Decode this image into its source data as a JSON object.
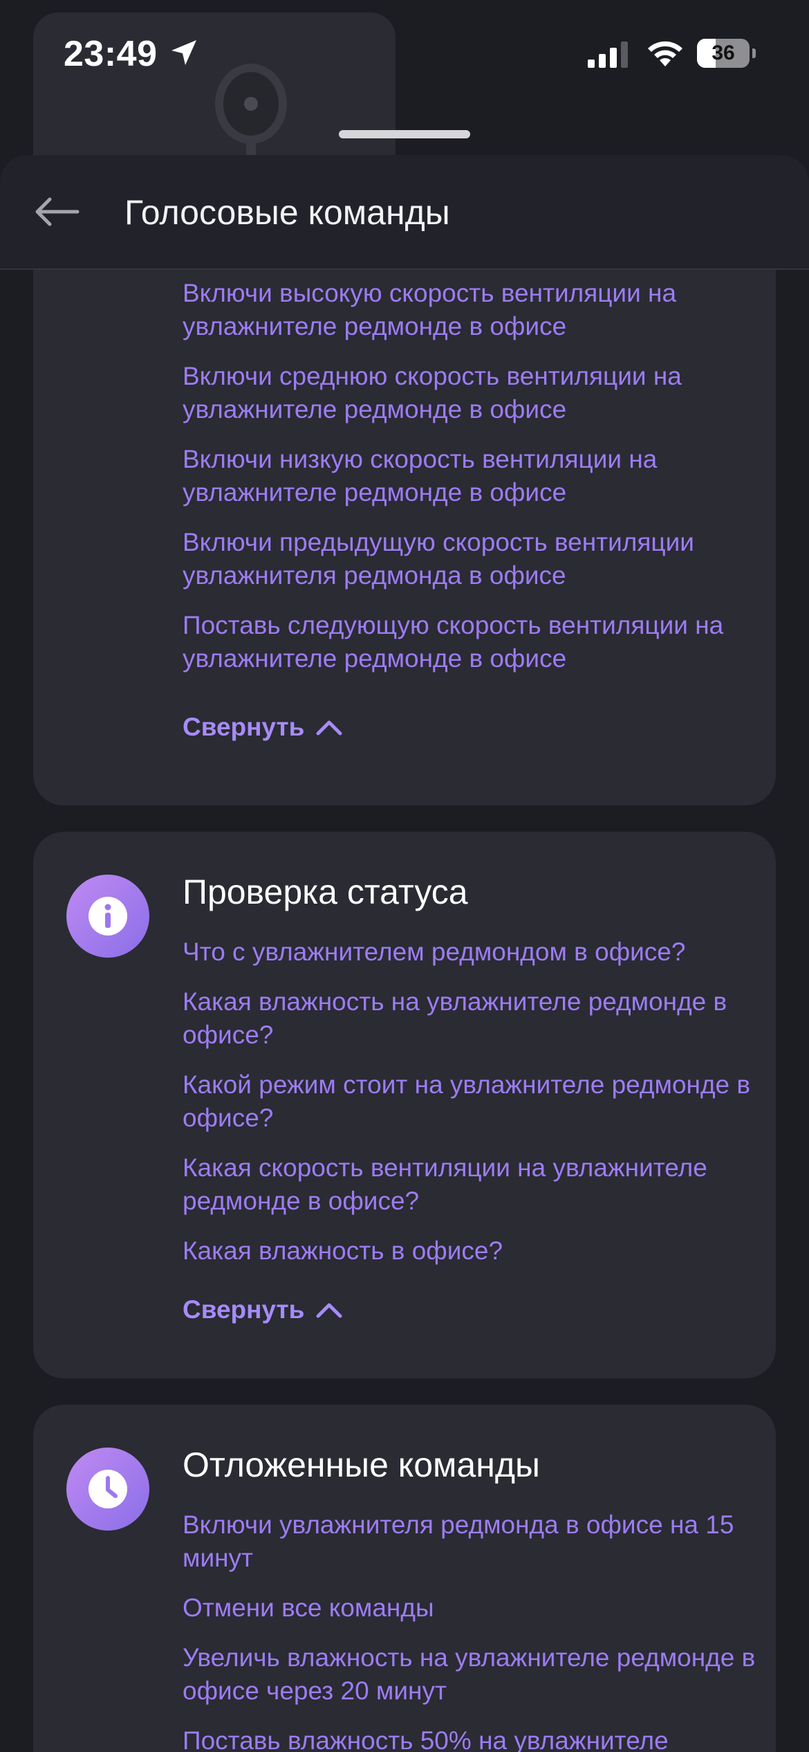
{
  "status_bar": {
    "time": "23:49",
    "battery_level": 36,
    "icons": [
      "location-arrow-icon",
      "cellular-signal-icon",
      "wifi-icon",
      "battery-icon"
    ]
  },
  "header": {
    "title": "Голосовые команды",
    "back_icon": "arrow-left-icon"
  },
  "colors": {
    "background": "#1c1d22",
    "card": "#2a2b33",
    "command_text": "#9d7cf4",
    "accent": "#a78bfa"
  },
  "cards": [
    {
      "icon": "fan-speed-icon",
      "icon_color": "#4fb3f0",
      "title": "",
      "commands": [
        "Включи высокую скорость вентиляции на увлажнителе редмонде в офисе",
        "Включи среднюю скорость вентиляции на увлажнителе редмонде в офисе",
        "Включи низкую скорость вентиляции на увлажнителе редмонде в офисе",
        "Включи предыдущую скорость вентиляции увлажнителя редмонда в офисе",
        "Поставь следующую скорость вентиляции на увлажнителе редмонде в офисе"
      ],
      "collapse_label": "Свернуть"
    },
    {
      "icon": "info-icon",
      "icon_color": "#a77cf0",
      "title": "Проверка статуса",
      "commands": [
        "Что с увлажнителем редмондом в офисе?",
        "Какая влажность на увлажнителе редмонде в офисе?",
        "Какой режим стоит на увлажнителе редмонде в офисе?",
        "Какая скорость вентиляции на увлажнителе редмонде в офисе?",
        "Какая влажность в офисе?"
      ],
      "collapse_label": "Свернуть"
    },
    {
      "icon": "clock-icon",
      "icon_color": "#a77cf0",
      "title": "Отложенные команды",
      "commands": [
        "Включи увлажнителя редмонда в офисе на 15 минут",
        "Отмени все команды",
        "Увеличь влажность на увлажнителе редмонде в офисе через 20 минут",
        "Поставь влажность 50% на увлажнителе"
      ]
    }
  ]
}
